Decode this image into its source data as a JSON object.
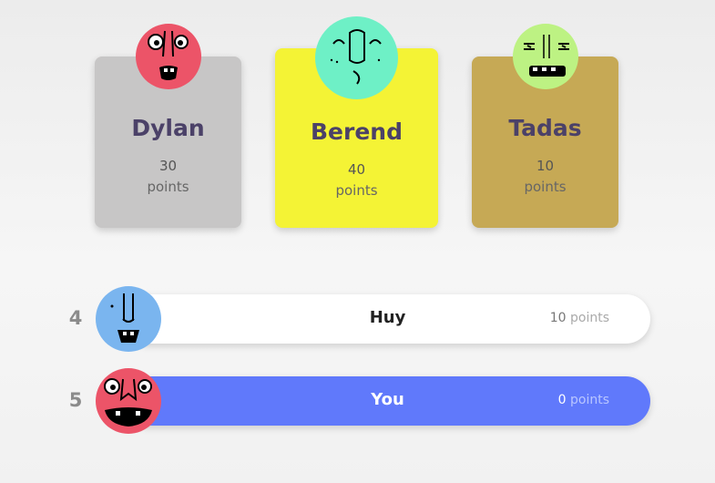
{
  "podium": [
    {
      "name": "Dylan",
      "points": "30",
      "unit": "points",
      "color": "#c7c6c6",
      "avatar_color": "#ec5468"
    },
    {
      "name": "Berend",
      "points": "40",
      "unit": "points",
      "color": "#f4f335",
      "avatar_color": "#6ef0c6"
    },
    {
      "name": "Tadas",
      "points": "10",
      "unit": "points",
      "color": "#c6a955",
      "avatar_color": "#bdf283"
    }
  ],
  "rows": [
    {
      "rank": "4",
      "name": "Huy",
      "points": "10",
      "unit": "points",
      "bg": "#ffffff",
      "avatar_color": "#7ab5ef"
    },
    {
      "rank": "5",
      "name": "You",
      "points": "0",
      "unit": "points",
      "bg": "#6079fb",
      "avatar_color": "#ec5468"
    }
  ]
}
